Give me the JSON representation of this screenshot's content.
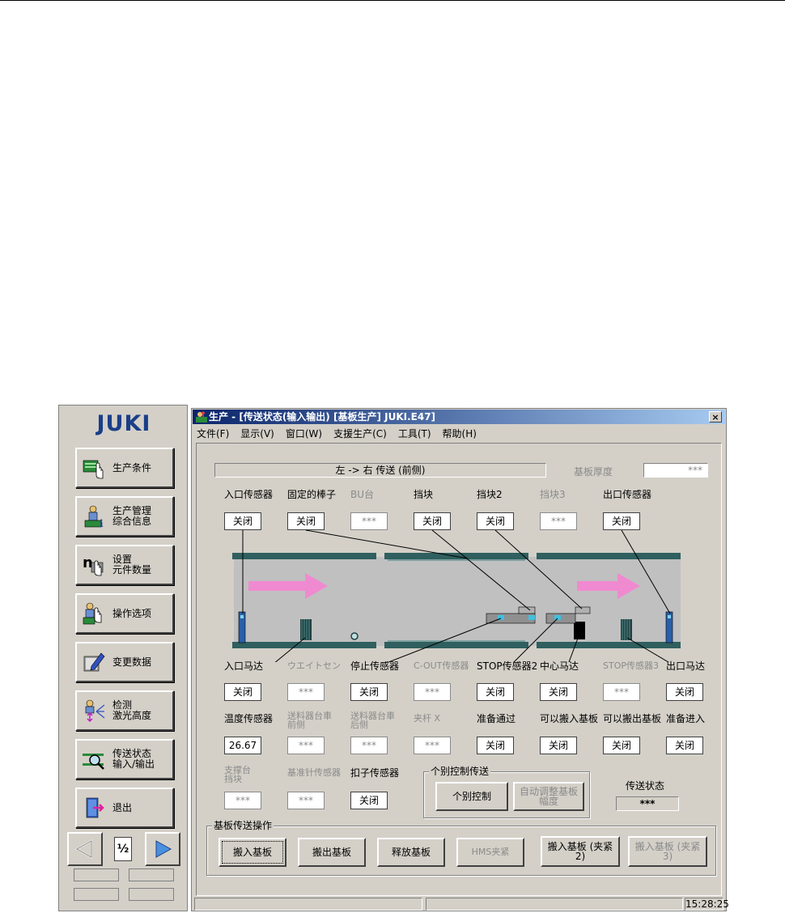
{
  "left_panel": {
    "logo": "JUKI",
    "buttons": [
      {
        "label": "生产条件",
        "icon": "production-condition-icon"
      },
      {
        "label": "生产管理\n综合信息",
        "icon": "production-info-icon"
      },
      {
        "label": "设置\n元件数量",
        "icon": "component-count-icon"
      },
      {
        "label": "操作选项",
        "icon": "operation-option-icon"
      },
      {
        "label": "变更数据",
        "icon": "edit-data-icon"
      },
      {
        "label": "检测\n激光高度",
        "icon": "laser-height-icon"
      },
      {
        "label": "传送状态\n输入/输出",
        "icon": "conveyor-status-icon"
      },
      {
        "label": "退出",
        "icon": "exit-icon"
      }
    ],
    "pager": {
      "page": "½"
    }
  },
  "window": {
    "title": "生产 - [传送状态(输入输出) [基板生产] JUKI.E47]",
    "close": "×",
    "menu": [
      "文件(F)",
      "显示(V)",
      "窗口(W)",
      "支援生产(C)",
      "工具(T)",
      "帮助(H)"
    ]
  },
  "conveyor": {
    "direction": "左 -> 右 传送 (前侧)",
    "thickness_label": "基板厚度",
    "thickness_value": "***",
    "top_sensors": [
      {
        "label": "入口传感器",
        "value": "关闭",
        "enabled": true
      },
      {
        "label": "固定的棒子",
        "value": "关闭",
        "enabled": true
      },
      {
        "label": "BU台",
        "value": "***",
        "enabled": false
      },
      {
        "label": "挡块",
        "value": "关闭",
        "enabled": true
      },
      {
        "label": "挡块2",
        "value": "关闭",
        "enabled": true
      },
      {
        "label": "挡块3",
        "value": "***",
        "enabled": false
      },
      {
        "label": "出口传感器",
        "value": "关闭",
        "enabled": true
      }
    ],
    "row1": [
      {
        "label": "入口马达",
        "value": "关闭",
        "enabled": true
      },
      {
        "label": "ウエイトセン",
        "value": "***",
        "enabled": false
      },
      {
        "label": "停止传感器",
        "value": "关闭",
        "enabled": true
      },
      {
        "label": "C-OUT传感器",
        "value": "***",
        "enabled": false
      },
      {
        "label": "STOP传感器2",
        "value": "关闭",
        "enabled": true
      },
      {
        "label": "中心马达",
        "value": "关闭",
        "enabled": true
      },
      {
        "label": "STOP传感器3",
        "value": "***",
        "enabled": false
      },
      {
        "label": "出口马达",
        "value": "关闭",
        "enabled": true
      }
    ],
    "row2": [
      {
        "label": "温度传感器",
        "value": "26.67",
        "enabled": true
      },
      {
        "label": "送料器台車\n前侧",
        "value": "***",
        "enabled": false
      },
      {
        "label": "送料器台車\n后侧",
        "value": "***",
        "enabled": false
      },
      {
        "label": "夹杆 X",
        "value": "***",
        "enabled": false
      },
      {
        "label": "准备通过",
        "value": "关闭",
        "enabled": true
      },
      {
        "label": "可以搬入基板",
        "value": "关闭",
        "enabled": true
      },
      {
        "label": "可以搬出基板",
        "value": "关闭",
        "enabled": true
      },
      {
        "label": "准备进入",
        "value": "关闭",
        "enabled": true
      }
    ],
    "row3": [
      {
        "label": "支撑台\n挡块",
        "value": "***",
        "enabled": false
      },
      {
        "label": "基准针传感器",
        "value": "***",
        "enabled": false
      },
      {
        "label": "扣子传感器",
        "value": "关闭",
        "enabled": true
      }
    ],
    "individual_group": {
      "title": "个别控制传送",
      "individual_btn": "个别控制",
      "auto_width_btn": "自动调整基板\n幅度"
    },
    "transfer_status_label": "传送状态",
    "transfer_status_value": "***",
    "ops_group": {
      "title": "基板传送操作",
      "buttons": [
        {
          "label": "搬入基板",
          "enabled": true
        },
        {
          "label": "搬出基板",
          "enabled": true
        },
        {
          "label": "释放基板",
          "enabled": true
        },
        {
          "label": "HMS夹紧",
          "enabled": false
        },
        {
          "label": "搬入基板 (夹紧\n2)",
          "enabled": true
        },
        {
          "label": "搬入基板 (夹紧\n3)",
          "enabled": false
        }
      ]
    }
  },
  "statusbar": {
    "time": "15:28:25"
  },
  "colors": {
    "accent": "#1a3f88",
    "rail": "#2f5f5f",
    "arrow": "#f08ad0",
    "sensor": "#2a5fa8"
  }
}
